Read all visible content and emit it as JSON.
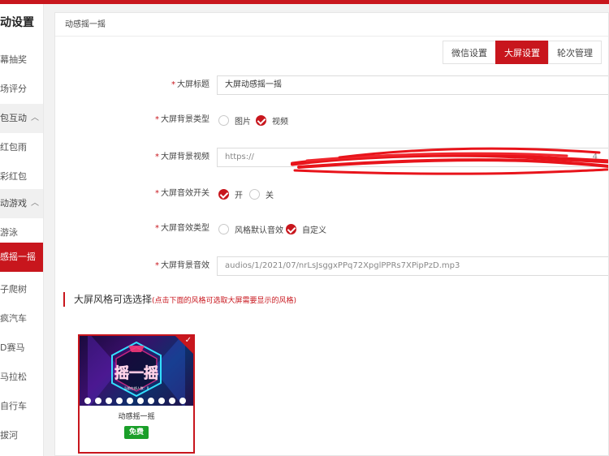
{
  "colors": {
    "accent": "#c8161d",
    "badge": "#1a9f29"
  },
  "sidebar": {
    "title": "动设置",
    "items": [
      {
        "label": "幕抽奖",
        "kind": "item"
      },
      {
        "label": "场评分",
        "kind": "item"
      },
      {
        "label": "包互动",
        "kind": "group"
      },
      {
        "label": "红包雨",
        "kind": "item"
      },
      {
        "label": "彩红包",
        "kind": "item"
      },
      {
        "label": "动游戏",
        "kind": "group"
      },
      {
        "label": "游泳",
        "kind": "item"
      },
      {
        "label": "感摇一摇",
        "kind": "active"
      },
      {
        "label": "子爬树",
        "kind": "item"
      },
      {
        "label": "疯汽车",
        "kind": "item"
      },
      {
        "label": "D赛马",
        "kind": "item"
      },
      {
        "label": "马拉松",
        "kind": "item"
      },
      {
        "label": "自行车",
        "kind": "item"
      },
      {
        "label": "拔河",
        "kind": "item"
      }
    ]
  },
  "panel": {
    "title": "动感摇一摇"
  },
  "tabs": [
    {
      "label": "微信设置",
      "active": false
    },
    {
      "label": "大屏设置",
      "active": true
    },
    {
      "label": "轮次管理",
      "active": false
    }
  ],
  "form": {
    "title": {
      "label": "大屏标题",
      "value": "大屏动感摇一摇"
    },
    "bg_type": {
      "label": "大屏背景类型",
      "options": [
        "图片",
        "视频"
      ],
      "selected": "视频"
    },
    "bg_video": {
      "label": "大屏背景视频",
      "value": "https://",
      "tail": "4"
    },
    "audio_switch": {
      "label": "大屏音效开关",
      "options": [
        "开",
        "关"
      ],
      "selected": "开"
    },
    "audio_type": {
      "label": "大屏音效类型",
      "options": [
        "风格默认音效",
        "自定义"
      ],
      "selected": "自定义"
    },
    "bg_audio": {
      "label": "大屏背景音效",
      "value": "audios/1/2021/07/nrLsJsggxPPq72XpglPPRs7XPipPzD.mp3"
    }
  },
  "styles": {
    "heading": "大屏风格可选选择",
    "hint": "(点击下面的风格可选取大屏需要显示的风格)",
    "cards": [
      {
        "name": "动感摇一摇",
        "badge": "免费",
        "selected": true,
        "art_title": "摇一摇",
        "art_caption": "当前在线人数：0"
      }
    ]
  }
}
